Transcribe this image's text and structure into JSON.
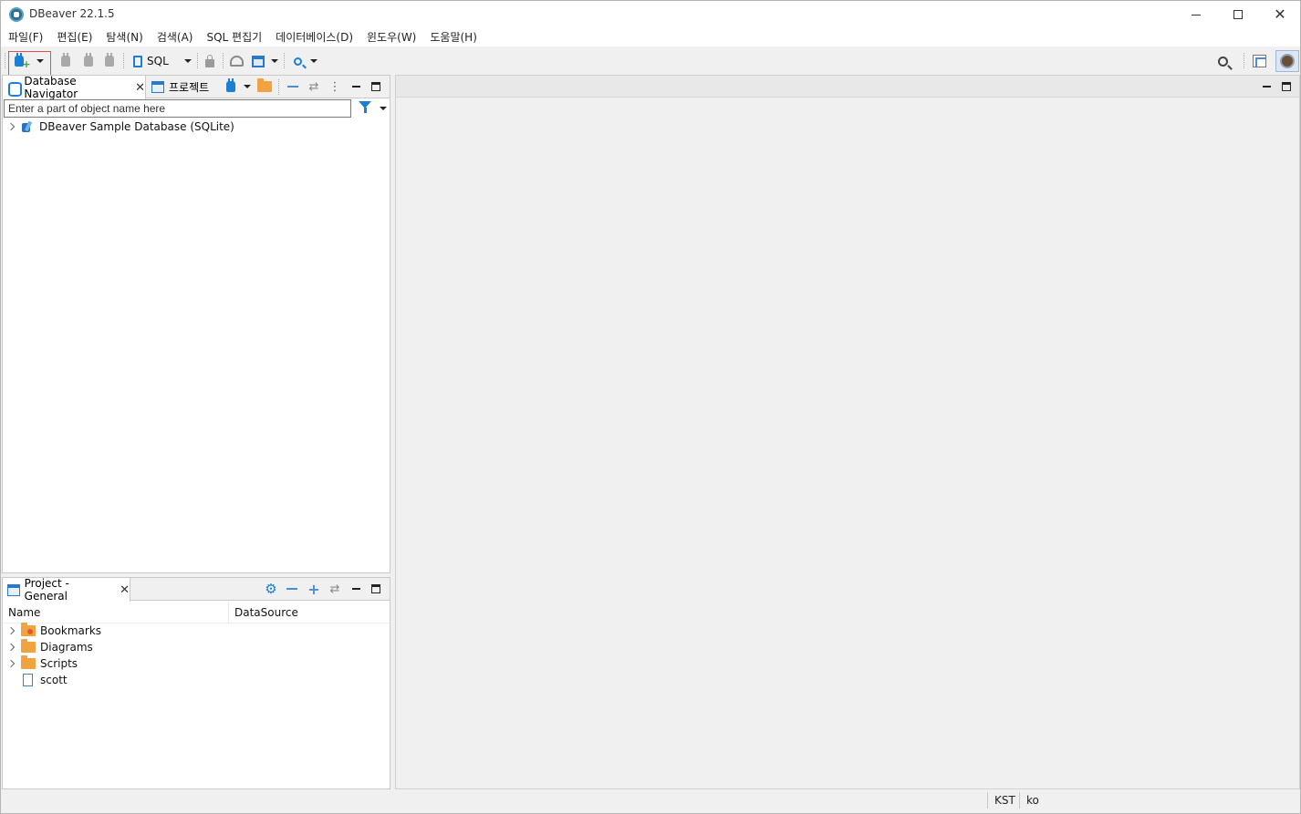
{
  "window": {
    "title": "DBeaver 22.1.5",
    "minimize_icon": "minimize-icon",
    "maximize_icon": "maximize-icon",
    "close_icon": "close-icon",
    "close_glyph": "✕"
  },
  "menu": {
    "items": [
      "파일(F)",
      "편집(E)",
      "탐색(N)",
      "검색(A)",
      "SQL 편집기",
      "데이터베이스(D)",
      "윈도우(W)",
      "도움말(H)"
    ]
  },
  "toolbar": {
    "sql_label": "SQL",
    "highlight_color": "#e05050",
    "accent": "#1c7fd3"
  },
  "navigator": {
    "tab_label": "Database Navigator",
    "projects_tab_label": "프로젝트",
    "close_glyph": "✕",
    "filter_placeholder": "Enter a part of object name here",
    "tree": [
      {
        "label": "DBeaver Sample Database (SQLite)"
      }
    ]
  },
  "project": {
    "tab_label": "Project - General",
    "close_glyph": "✕",
    "columns": [
      "Name",
      "DataSource"
    ],
    "items": [
      {
        "label": "Bookmarks",
        "datasource": ""
      },
      {
        "label": "Diagrams",
        "datasource": ""
      },
      {
        "label": "Scripts",
        "datasource": ""
      },
      {
        "label": "scott",
        "datasource": ""
      }
    ]
  },
  "status": {
    "timezone": "KST",
    "locale": "ko"
  }
}
